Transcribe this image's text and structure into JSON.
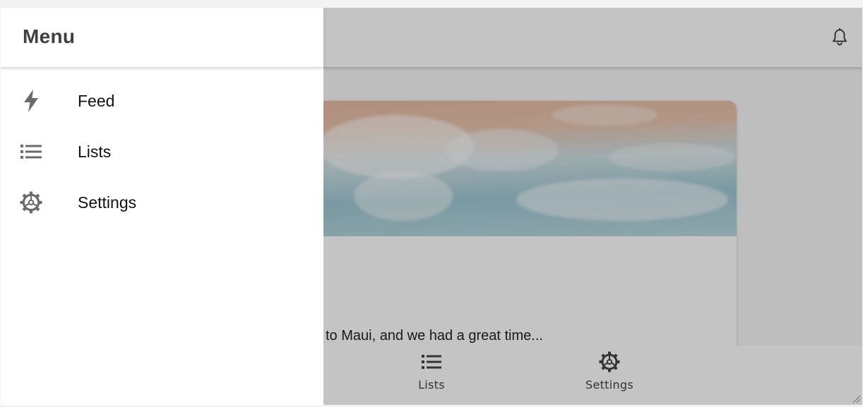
{
  "drawer": {
    "title": "Menu",
    "items": [
      {
        "label": "Feed",
        "icon": "lightning-bolt-icon"
      },
      {
        "label": "Lists",
        "icon": "list-icon"
      },
      {
        "label": "Settings",
        "icon": "gear-icon"
      }
    ]
  },
  "header": {
    "notifications_icon": "bell-icon"
  },
  "card": {
    "excerpt": "to Maui, and we had a great time..."
  },
  "bottom_nav": {
    "items": [
      {
        "label": "Lists",
        "icon": "list-icon"
      },
      {
        "label": "Settings",
        "icon": "gear-icon"
      }
    ]
  },
  "colors": {
    "scrim": "#000000",
    "icon": "#6b6b6b",
    "drawer_background": "#ffffff"
  }
}
